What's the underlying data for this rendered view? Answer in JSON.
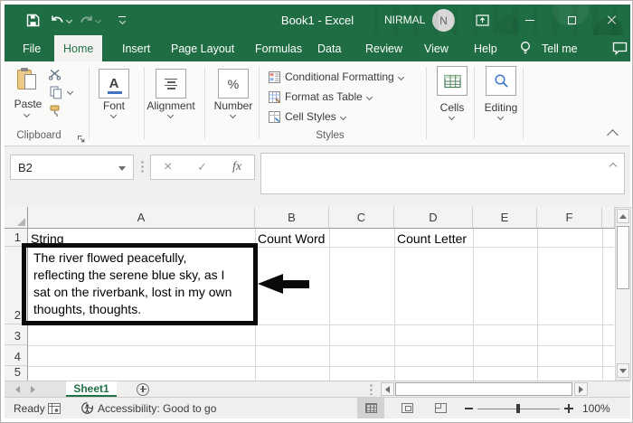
{
  "window": {
    "title": "Book1 - Excel",
    "user": "NIRMAL",
    "avatar_initial": "N"
  },
  "ribbon_tabs": {
    "file": "File",
    "home": "Home",
    "insert": "Insert",
    "page_layout": "Page Layout",
    "formulas": "Formulas",
    "data": "Data",
    "review": "Review",
    "view": "View",
    "help": "Help",
    "tell_me": "Tell me"
  },
  "ribbon": {
    "paste": "Paste",
    "clipboard_group": "Clipboard",
    "font_group": "Font",
    "font_icon_letter": "A",
    "alignment_group": "Alignment",
    "number_group": "Number",
    "number_icon": "%",
    "conditional_formatting": "Conditional Formatting",
    "format_as_table": "Format as Table",
    "cell_styles": "Cell Styles",
    "styles_group": "Styles",
    "cells_group": "Cells",
    "editing_group": "Editing"
  },
  "formula_bar": {
    "name_box": "B2",
    "fx_label": "fx",
    "formula_value": ""
  },
  "grid": {
    "column_headers": [
      "A",
      "B",
      "C",
      "D",
      "E",
      "F"
    ],
    "row_headers": [
      "1",
      "2",
      "3",
      "4",
      "5"
    ],
    "cells": {
      "A1": "String",
      "B1": "Count Word",
      "D1": "Count Letter"
    },
    "a2_lines": [
      "The river flowed peacefully,",
      "reflecting the serene blue sky, as I",
      "sat on the riverbank, lost in my own",
      "thoughts, thoughts."
    ],
    "a2_full_text": "The river flowed peacefully, reflecting the serene blue sky, as I sat on the riverbank, lost in my own thoughts, thoughts."
  },
  "sheet_bar": {
    "active_tab": "Sheet1"
  },
  "status_bar": {
    "ready": "Ready",
    "accessibility": "Accessibility: Good to go",
    "zoom_level": "100%"
  },
  "icons": {
    "cancel": "×",
    "enter": "✓"
  },
  "colors": {
    "excel_green": "#217346",
    "title_bar_green": "#1f6e43",
    "annotation_black": "#0a0a0a",
    "font_underline_blue": "#4472c4"
  }
}
